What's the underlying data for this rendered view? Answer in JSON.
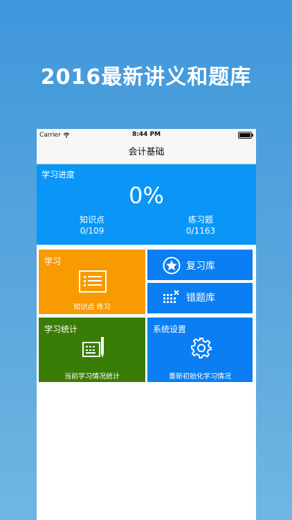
{
  "headline": "2016最新讲义和题库",
  "status_bar": {
    "carrier": "Carrier",
    "time": "8:44 PM"
  },
  "nav": {
    "title": "会计基础"
  },
  "progress": {
    "title": "学习进度",
    "percent": "0%",
    "knowledge": {
      "label": "知识点",
      "value": "0/109"
    },
    "exercises": {
      "label": "练习题",
      "value": "0/1163"
    }
  },
  "tiles": {
    "study": {
      "label": "学习",
      "sub": "知识点 练习",
      "icon": "list-card-icon"
    },
    "review": {
      "label": "复习库",
      "icon": "star-icon"
    },
    "wrong": {
      "label": "错题库",
      "icon": "grid-x-icon"
    },
    "stats": {
      "label": "学习统计",
      "sub": "当前学习情况统计",
      "icon": "notepad-pen-icon"
    },
    "settings": {
      "label": "系统设置",
      "sub": "重新初始化学习情况",
      "icon": "gear-icon"
    }
  },
  "colors": {
    "progress_bg": "#0a96f6",
    "study_bg": "#f89b00",
    "blue_tile_bg": "#0a7ef2",
    "stats_bg": "#3a7d06"
  }
}
